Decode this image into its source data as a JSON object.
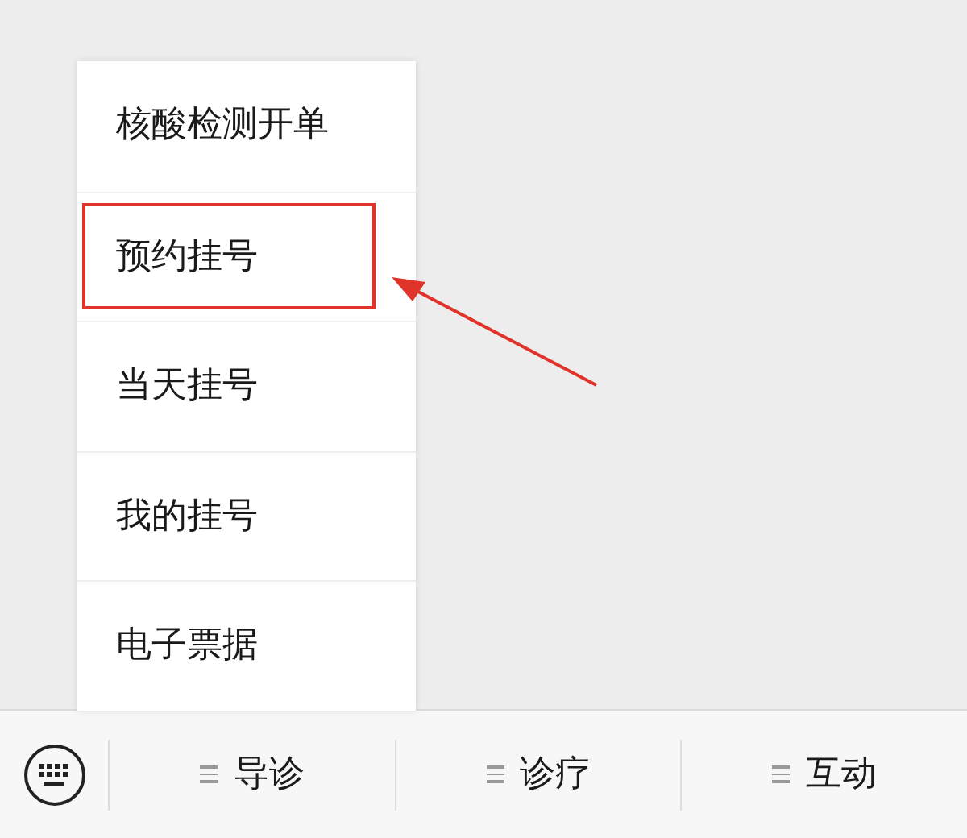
{
  "menu": {
    "items": [
      {
        "label": "核酸检测开单",
        "annotated": false
      },
      {
        "label": "预约挂号",
        "annotated": true
      },
      {
        "label": "当天挂号",
        "annotated": false
      },
      {
        "label": "我的挂号",
        "annotated": false
      },
      {
        "label": "电子票据",
        "annotated": false
      }
    ]
  },
  "bottom_bar": {
    "tabs": [
      {
        "label": "导诊"
      },
      {
        "label": "诊疗"
      },
      {
        "label": "互动"
      }
    ]
  }
}
